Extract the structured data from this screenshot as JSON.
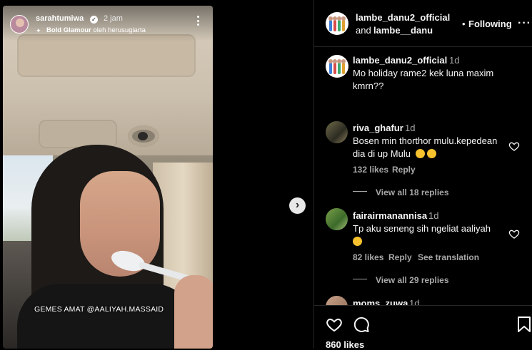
{
  "story": {
    "username": "sarahtumiwa",
    "time": "2 jam",
    "effect_name": "Bold Glamour",
    "effect_by": "oleh herusugiarta",
    "caption": "GEMES AMAT @AALIYAH.MASSAID"
  },
  "header": {
    "user1": "lambe_danu2_official",
    "and_text": "and",
    "user2": "lambe__danu",
    "follow_label": "Following",
    "more_label": "···"
  },
  "caption": {
    "username": "lambe_danu2_official",
    "time": "1d",
    "text": "Mo holiday rame2 kek luna maxim kmrn??"
  },
  "comments": [
    {
      "username": "riva_ghafur",
      "time": "1d",
      "text": "Bosen min thorthor mulu.kepedean dia di up Mulu",
      "likes": "132 likes",
      "reply_label": "Reply",
      "view_replies": "View all 18 replies"
    },
    {
      "username": "fairairmanannisa",
      "time": "1d",
      "text": "Tp aku seneng sih ngeliat aaliyah",
      "likes": "82 likes",
      "reply_label": "Reply",
      "translate_label": "See translation",
      "view_replies": "View all 29 replies"
    },
    {
      "username": "moms_zuwa",
      "time": "1d"
    }
  ],
  "actions": {
    "likes": "860 likes"
  },
  "colors": {
    "background": "#000000",
    "text_primary": "#f5f5f5",
    "text_secondary": "#a8a8a8",
    "divider": "#262626"
  },
  "icons": [
    "verified-icon",
    "effect-sparkle-icon",
    "more-vertical-icon",
    "next-arrow-icon",
    "more-horizontal-icon",
    "heart-icon",
    "comment-icon",
    "bookmark-icon"
  ]
}
